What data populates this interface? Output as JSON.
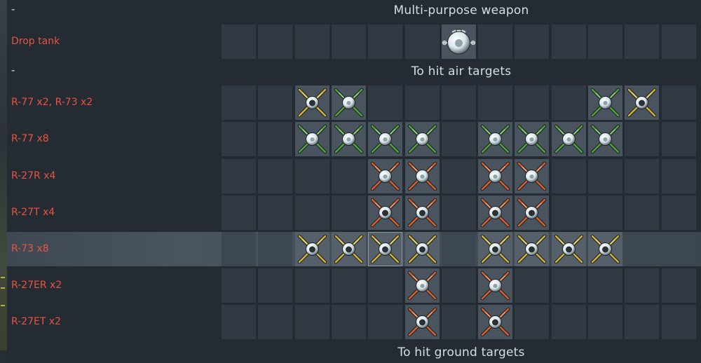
{
  "sections": [
    {
      "dash": "-",
      "title": "Multi-purpose weapon",
      "rows": [
        {
          "label": "Drop tank",
          "slots": {
            "6": "tank"
          }
        }
      ]
    },
    {
      "dash": "-",
      "title": "To hit air targets",
      "rows": [
        {
          "label": "R-77 x2,  R-73 x2",
          "slots": {
            "2": "r73",
            "3": "r77",
            "10": "r77",
            "11": "r73"
          }
        },
        {
          "label": "R-77 x8",
          "slots": {
            "2": "r77",
            "3": "r77",
            "4": "r77",
            "5": "r77",
            "7": "r77",
            "8": "r77",
            "9": "r77",
            "10": "r77"
          }
        },
        {
          "label": "R-27R x4",
          "slots": {
            "4": "r27r",
            "5": "r27r",
            "7": "r27r",
            "8": "r27r"
          }
        },
        {
          "label": "R-27T x4",
          "slots": {
            "4": "r27t",
            "5": "r27t",
            "7": "r27t",
            "8": "r27t"
          }
        },
        {
          "label": "R-73 x8",
          "selected": true,
          "highlight_slot": 4,
          "slots": {
            "2": "r73",
            "3": "r73",
            "4": "r73",
            "5": "r73",
            "7": "r73",
            "8": "r73",
            "9": "r73",
            "10": "r73"
          }
        },
        {
          "label": "R-27ER x2",
          "slots": {
            "5": "r27er",
            "7": "r27er"
          }
        },
        {
          "label": "R-27ET x2",
          "slots": {
            "5": "r27et",
            "7": "r27et"
          }
        }
      ]
    },
    {
      "title": "To hit ground targets",
      "rows": []
    }
  ],
  "colors": {
    "label": "#e8553f",
    "title": "#d7dde3",
    "r77_fins": "#4fa43b",
    "r73_fins": "#d1b33a",
    "r27_fins": "#d8602e",
    "head_light": "#d9e6ea",
    "head_dark": "#47545a"
  },
  "icons": {
    "tank": "drop-tank-icon",
    "r77": "r-77-missile-icon",
    "r73": "r-73-missile-icon",
    "r27r": "r-27r-missile-icon",
    "r27t": "r-27t-missile-icon",
    "r27er": "r-27er-missile-icon",
    "r27et": "r-27et-missile-icon"
  }
}
